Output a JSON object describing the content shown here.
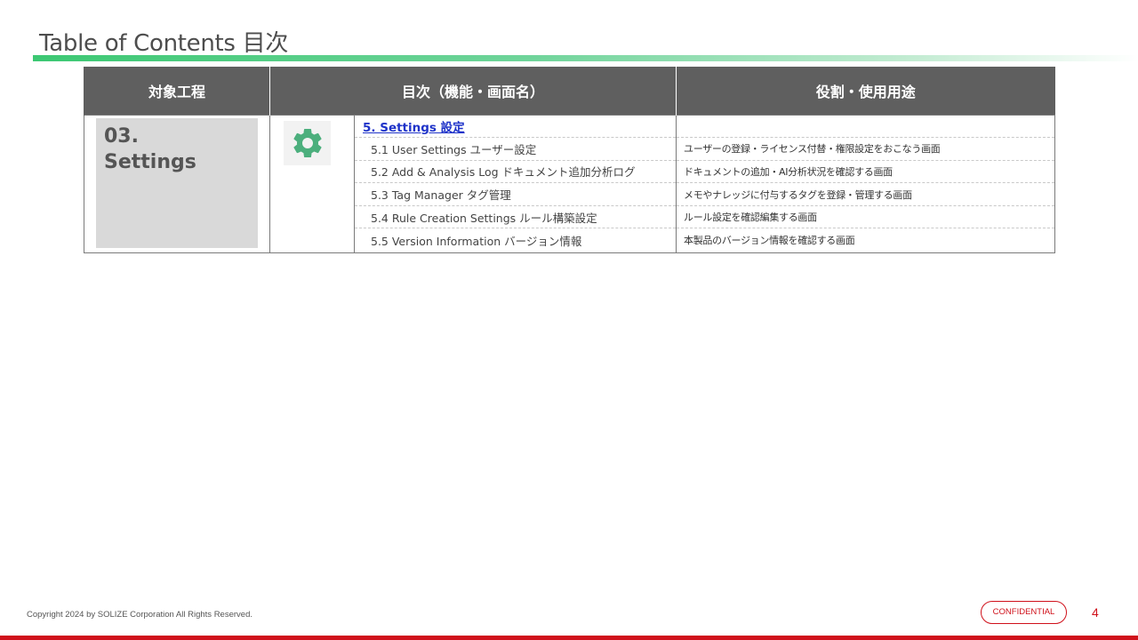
{
  "page": {
    "title": "Table of Contents  目次"
  },
  "table": {
    "headers": [
      "対象工程",
      "目次（機能・画面名）",
      "役割・使用用途"
    ],
    "process_label": "03.\nSettings",
    "section_link": "5. Settings  設定",
    "items": [
      {
        "label": "5.1 User  Settings  ユーザー設定",
        "role": "ユーザーの登録・ライセンス付替・権限設定をおこなう画面"
      },
      {
        "label": "5.2 Add & Analysis Log  ドキュメント追加分析ログ",
        "role": "ドキュメントの追加・AI分析状況を確認する画面"
      },
      {
        "label": "5.3 Tag Manager  タグ管理",
        "role": "メモやナレッジに付与するタグを登録・管理する画面"
      },
      {
        "label": "5.4 Rule Creation Settings  ルール構築設定",
        "role": "ルール設定を確認編集する画面"
      },
      {
        "label": "5.5 Version Information  バージョン情報",
        "role": "本製品のバージョン情報を確認する画面"
      }
    ]
  },
  "footer": {
    "copyright": "Copyright 2024 by SOLIZE Corporation All Rights Reserved.",
    "badge": "CONFIDENTIAL",
    "page_number": "4"
  },
  "colors": {
    "accent_green": "#3cc873",
    "icon_green": "#4caf7d",
    "header_gray": "#5f5f5f",
    "link_blue": "#1f33c9",
    "footer_red": "#d0111b"
  },
  "icons": {
    "section_icon": "gear-icon"
  }
}
